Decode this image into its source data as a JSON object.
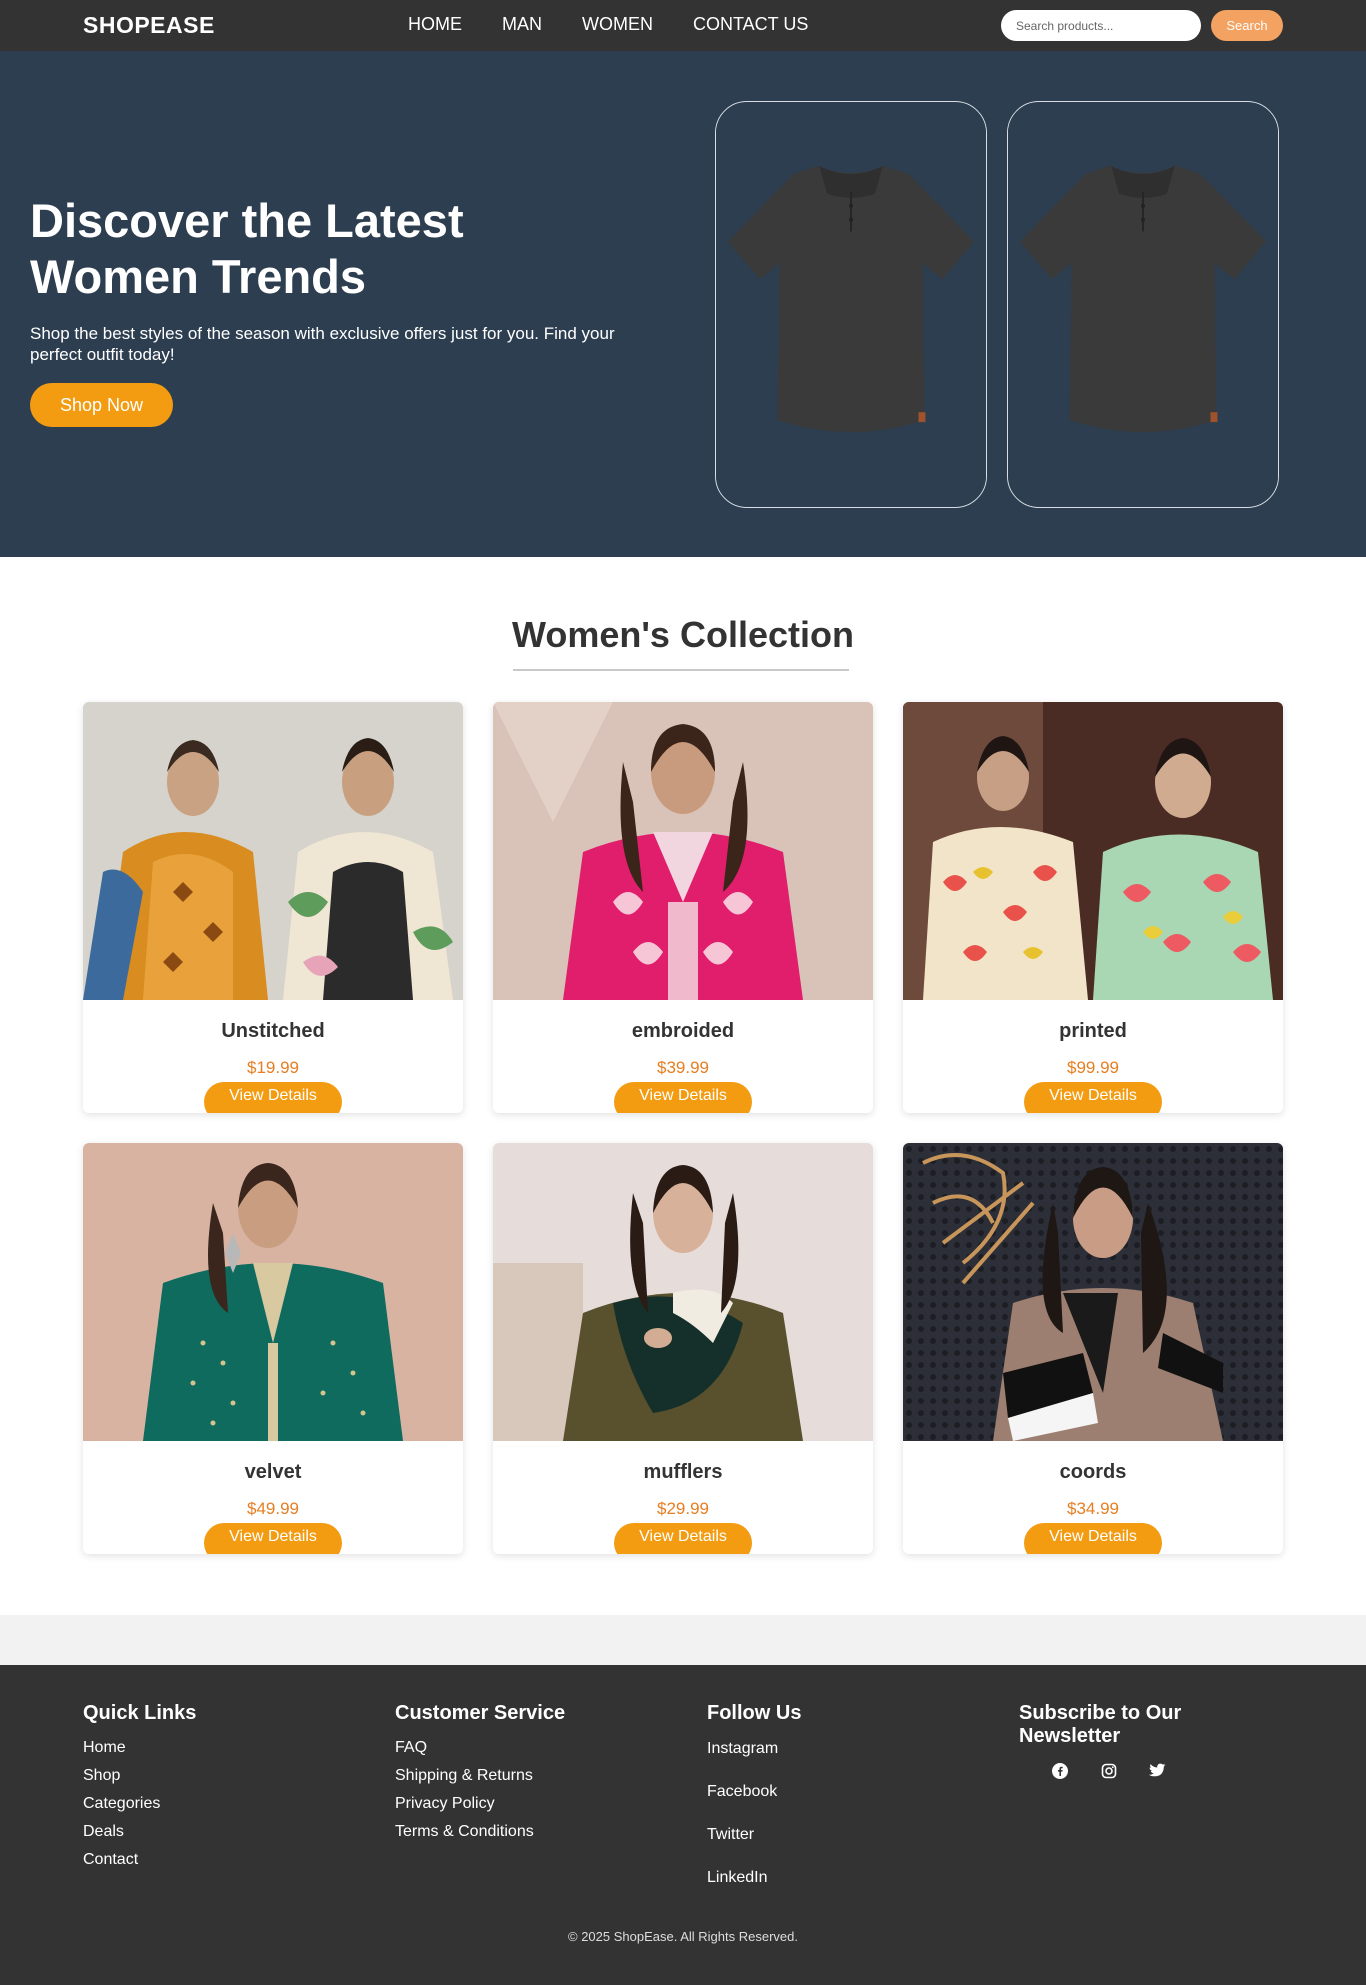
{
  "brand": "SHOPEASE",
  "nav": {
    "items": [
      "HOME",
      "MAN",
      "WOMEN",
      "CONTACT US"
    ]
  },
  "search": {
    "placeholder": "Search products...",
    "button": "Search"
  },
  "hero": {
    "title": "Discover the Latest Women Trends",
    "subtitle": "Shop the best styles of the season with exclusive offers just for you. Find your perfect outfit today!",
    "cta": "Shop Now"
  },
  "collection": {
    "title": "Women's Collection",
    "button_label": "View Details",
    "products": [
      {
        "name": "Unstitched",
        "price": "$19.99"
      },
      {
        "name": "embroided",
        "price": "$39.99"
      },
      {
        "name": "printed",
        "price": "$99.99"
      },
      {
        "name": "velvet",
        "price": "$49.99"
      },
      {
        "name": "mufflers",
        "price": "$29.99"
      },
      {
        "name": "coords",
        "price": "$34.99"
      }
    ]
  },
  "footer": {
    "quick_links": {
      "title": "Quick Links",
      "items": [
        "Home",
        "Shop",
        "Categories",
        "Deals",
        "Contact"
      ]
    },
    "customer_service": {
      "title": "Customer Service",
      "items": [
        "FAQ",
        "Shipping & Returns",
        "Privacy Policy",
        "Terms & Conditions"
      ]
    },
    "follow_us": {
      "title": "Follow Us",
      "items": [
        "Instagram",
        "Facebook",
        "Twitter",
        "LinkedIn"
      ]
    },
    "newsletter": {
      "title": "Subscribe to Our Newsletter",
      "icons": [
        "facebook-icon",
        "instagram-icon",
        "twitter-icon"
      ]
    },
    "copyright": "© 2025 ShopEase. All Rights Reserved."
  },
  "colors": {
    "nav_bg": "#333333",
    "hero_bg": "#2c3e50",
    "accent": "#f39c12",
    "search_button": "#f4a261",
    "price": "#e67e22"
  }
}
